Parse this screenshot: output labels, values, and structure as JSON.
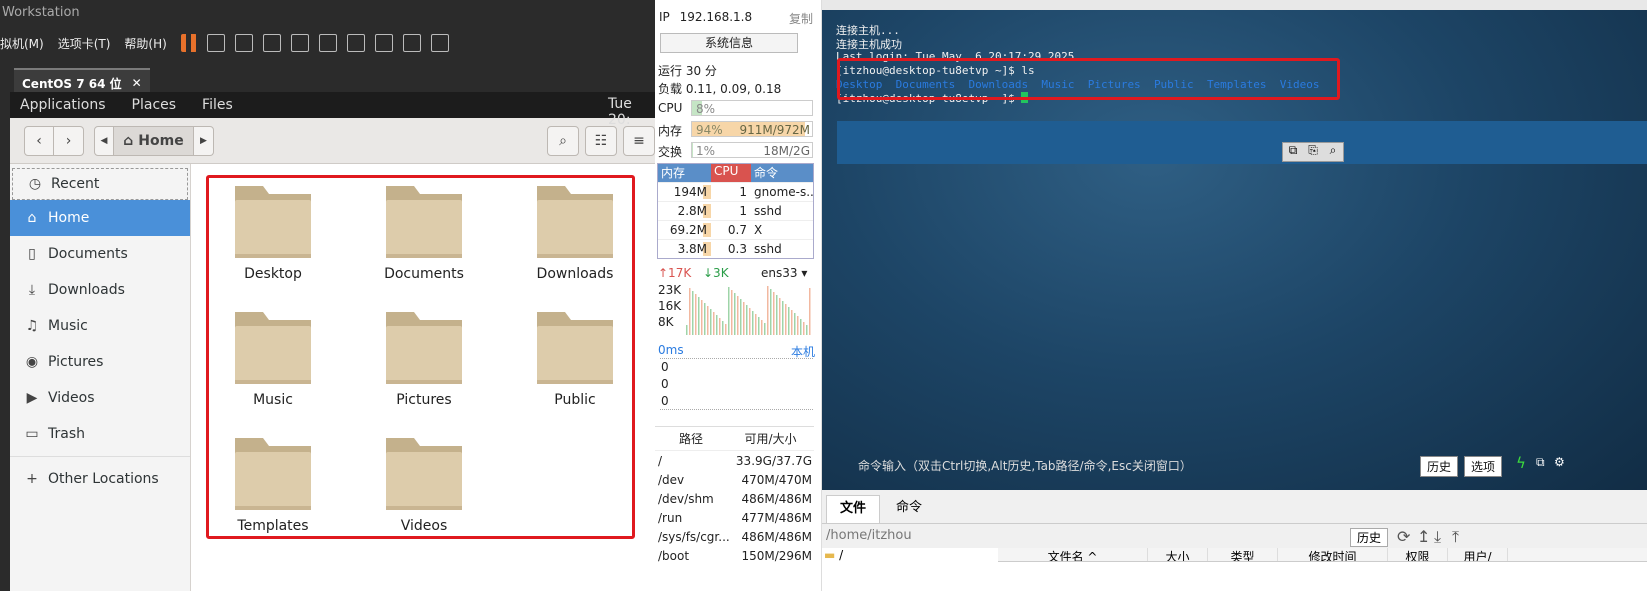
{
  "vm": {
    "title": "Workstation",
    "menu": [
      "拟机(M)",
      "选项卡(T)",
      "帮助(H)"
    ],
    "tab_label": "CentOS 7 64 位",
    "tab_close": "✕"
  },
  "gnome": {
    "applications": "Applications",
    "places": "Places",
    "files": "Files",
    "clock": "Tue 20:"
  },
  "nautilus": {
    "location": "Home",
    "sidebar": [
      {
        "label": "Recent",
        "icon": "clock-icon",
        "glyph": "◷"
      },
      {
        "label": "Home",
        "icon": "home-icon",
        "glyph": "⌂"
      },
      {
        "label": "Documents",
        "icon": "document-icon",
        "glyph": "▯"
      },
      {
        "label": "Downloads",
        "icon": "download-icon",
        "glyph": "⤓"
      },
      {
        "label": "Music",
        "icon": "music-icon",
        "glyph": "♫"
      },
      {
        "label": "Pictures",
        "icon": "camera-icon",
        "glyph": "◉"
      },
      {
        "label": "Videos",
        "icon": "video-icon",
        "glyph": "▶"
      },
      {
        "label": "Trash",
        "icon": "trash-icon",
        "glyph": "🗑"
      },
      {
        "label": "Other Locations",
        "icon": "plus-icon",
        "glyph": "+"
      }
    ],
    "folders": [
      "Desktop",
      "Documents",
      "Downloads",
      "Music",
      "Pictures",
      "Public",
      "Templates",
      "Videos"
    ]
  },
  "sysmon": {
    "ip_label": "IP",
    "ip": "192.168.1.8",
    "copy": "复制",
    "sysinfo": "系统信息",
    "uptime": "运行 30 分",
    "load": "负载 0.11, 0.09, 0.18",
    "cpu_label": "CPU",
    "cpu_value": "8%",
    "cpu_fraction": 0.08,
    "mem_label": "内存",
    "mem_pct": "94%",
    "mem_value": "911M/972M",
    "mem_fraction": 0.94,
    "swap_label": "交换",
    "swap_pct": "1%",
    "swap_value": "18M/2G",
    "swap_fraction": 0.01,
    "proc_headers": [
      "内存",
      "CPU",
      "命令"
    ],
    "processes": [
      {
        "mem": "194M",
        "cpu": "1",
        "cmd": "gnome-s..."
      },
      {
        "mem": "2.8M",
        "cpu": "1",
        "cmd": "sshd"
      },
      {
        "mem": "69.2M",
        "cpu": "0.7",
        "cmd": "X"
      },
      {
        "mem": "3.8M",
        "cpu": "0.3",
        "cmd": "sshd"
      }
    ],
    "net_up": "↑17K",
    "net_down": "↓3K",
    "net_iface": "ens33",
    "net_scale": [
      "23K",
      "16K",
      "8K"
    ],
    "latency": "0ms",
    "latency_host": "本机",
    "latency_vals": [
      "0",
      "0",
      "0"
    ],
    "disk_headers": [
      "路径",
      "可用/大小"
    ],
    "disks": [
      {
        "path": "/",
        "size": "33.9G/37.7G"
      },
      {
        "path": "/dev",
        "size": "470M/470M"
      },
      {
        "path": "/dev/shm",
        "size": "486M/486M"
      },
      {
        "path": "/run",
        "size": "477M/486M"
      },
      {
        "path": "/sys/fs/cgr...",
        "size": "486M/486M"
      },
      {
        "path": "/boot",
        "size": "150M/296M"
      }
    ]
  },
  "terminal": {
    "lines": [
      "连接主机...",
      "连接主机成功",
      "Last login: Tue May  6 20:17:29 2025",
      "[itzhou@desktop-tu8etvp ~]$ ls",
      "",
      "[itzhou@desktop-tu8etvp ~]$ "
    ],
    "ls_output": [
      "Desktop",
      "Documents",
      "Downloads",
      "Music",
      "Pictures",
      "Public",
      "Templates",
      "Videos"
    ],
    "cmd_hint": "命令输入（双击Ctrl切换,Alt历史,Tab路径/命令,Esc关闭窗口）",
    "history_btn": "历史",
    "options_btn": "选项"
  },
  "filepanel": {
    "tabs": [
      "文件",
      "命令"
    ],
    "path": "/home/itzhou",
    "history_btn": "历史",
    "tree_root": "/",
    "columns": [
      "文件名 ^",
      "大小",
      "类型",
      "修改时间",
      "权限",
      "用户/"
    ]
  },
  "colors": {
    "red_box": "#e0191f",
    "select_blue": "#4a90d9",
    "terminal_bg": "#1d4566",
    "ls_blue": "#2a7be0"
  }
}
